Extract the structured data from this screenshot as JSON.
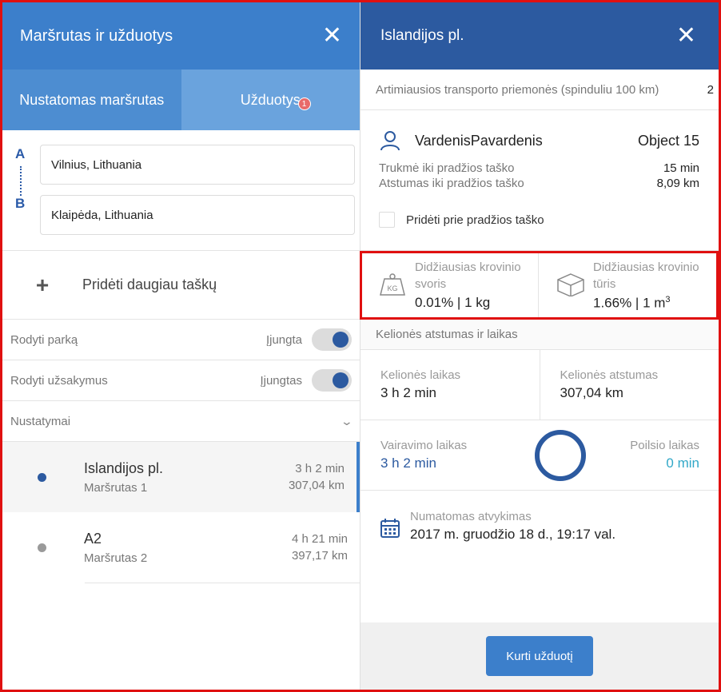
{
  "left": {
    "title": "Maršrutas ir užduotys",
    "tabs": [
      {
        "label": "Nustatomas maršrutas"
      },
      {
        "label": "Užduotys",
        "badge": "1"
      }
    ],
    "points": [
      {
        "letter": "A",
        "value": "Vilnius, Lithuania"
      },
      {
        "letter": "B",
        "value": "Klaipėda, Lithuania"
      }
    ],
    "add_more": "Pridėti daugiau taškų",
    "toggles": [
      {
        "label": "Rodyti parką",
        "state": "Įjungta"
      },
      {
        "label": "Rodyti užsakymus",
        "state": "Įjungtas"
      }
    ],
    "settings": "Nustatymai",
    "routes": [
      {
        "name": "Islandijos pl.",
        "sub": "Maršrutas 1",
        "time": "3 h 2 min",
        "dist": "307,04 km",
        "color": "#2c5aa0"
      },
      {
        "name": "A2",
        "sub": "Maršrutas 2",
        "time": "4 h 21 min",
        "dist": "397,17 km",
        "color": "#9a9a9a"
      }
    ]
  },
  "right": {
    "title": "Islandijos pl.",
    "nearby": {
      "label": "Artimiausios transporto priemonės (spinduliu 100 km)",
      "count": "2"
    },
    "driver": {
      "name": "VardenisPavardenis",
      "object": "Object 15",
      "lines": [
        {
          "label": "Trukmė iki pradžios taško",
          "value": "15 min"
        },
        {
          "label": "Atstumas iki pradžios taško",
          "value": "8,09 km"
        }
      ],
      "checkbox": "Pridėti prie pradžios taško"
    },
    "cargo": {
      "weight": {
        "label1": "Didžiausias krovinio",
        "label2": "svoris",
        "value": "0.01% | 1 kg",
        "icon_text": "KG"
      },
      "volume": {
        "label1": "Didžiausias krovinio",
        "label2": "tūris",
        "value": "1.66% | 1 m",
        "sup": "3"
      }
    },
    "trip_head": "Kelionės atstumas ir laikas",
    "trip": [
      {
        "label": "Kelionės laikas",
        "value": "3 h 2 min"
      },
      {
        "label": "Kelionės atstumas",
        "value": "307,04 km"
      }
    ],
    "driving": {
      "label": "Vairavimo laikas",
      "value": "3 h 2 min"
    },
    "rest": {
      "label": "Poilsio laikas",
      "value": "0 min"
    },
    "arrival": {
      "label": "Numatomas atvykimas",
      "value": "2017 m. gruodžio 18 d., 19:17 val."
    },
    "button": "Kurti užduotį"
  }
}
